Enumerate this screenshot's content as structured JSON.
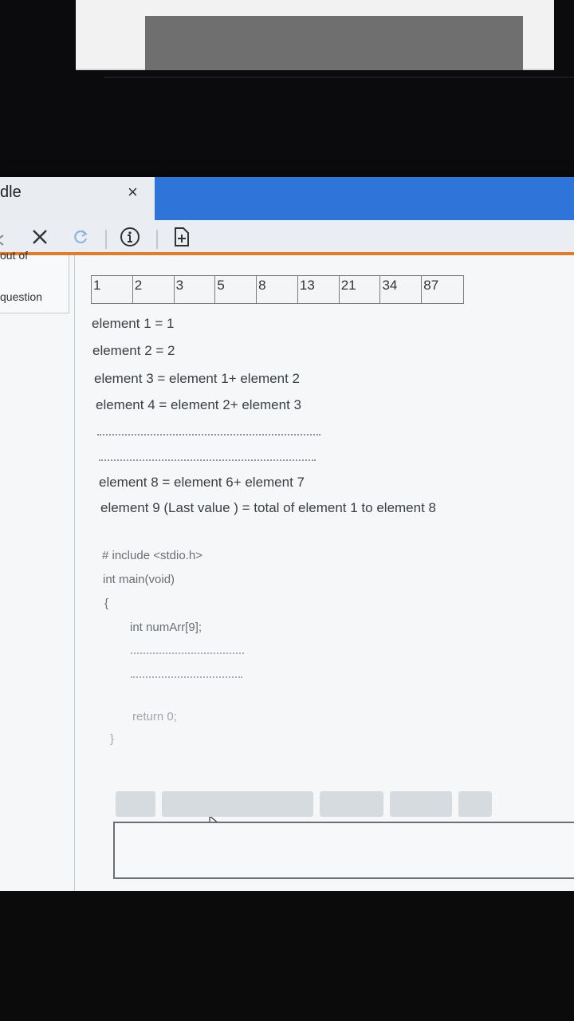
{
  "browser": {
    "tab_title": "dle",
    "tab_close": "×",
    "accent_color": "#e07b2a"
  },
  "toolbar": {
    "close": "×",
    "info_icon": "info-icon",
    "add_icon": "add-document-icon",
    "refresh_icon": "refresh-icon"
  },
  "sidebar": {
    "top_label": "out of",
    "question_label": "question"
  },
  "array_cells": [
    "1",
    "2",
    "3",
    "5",
    "8",
    "13",
    "21",
    "34",
    "87"
  ],
  "lines": {
    "l1": "element 1 = 1",
    "l2": "element 2 = 2",
    "l3": "element 3 = element 1+ element 2",
    "l4": "element 4 = element 2+ element 3",
    "l8": "element 8 = element 6+ element 7",
    "l9": "element 9 (Last value ) = total of element 1 to element 8"
  },
  "code": {
    "include": "# include <stdio.h>",
    "main": "int main(void)",
    "open_brace": "{",
    "decl": "int numArr[9];",
    "ret": "return 0;",
    "close_brace": "}"
  }
}
